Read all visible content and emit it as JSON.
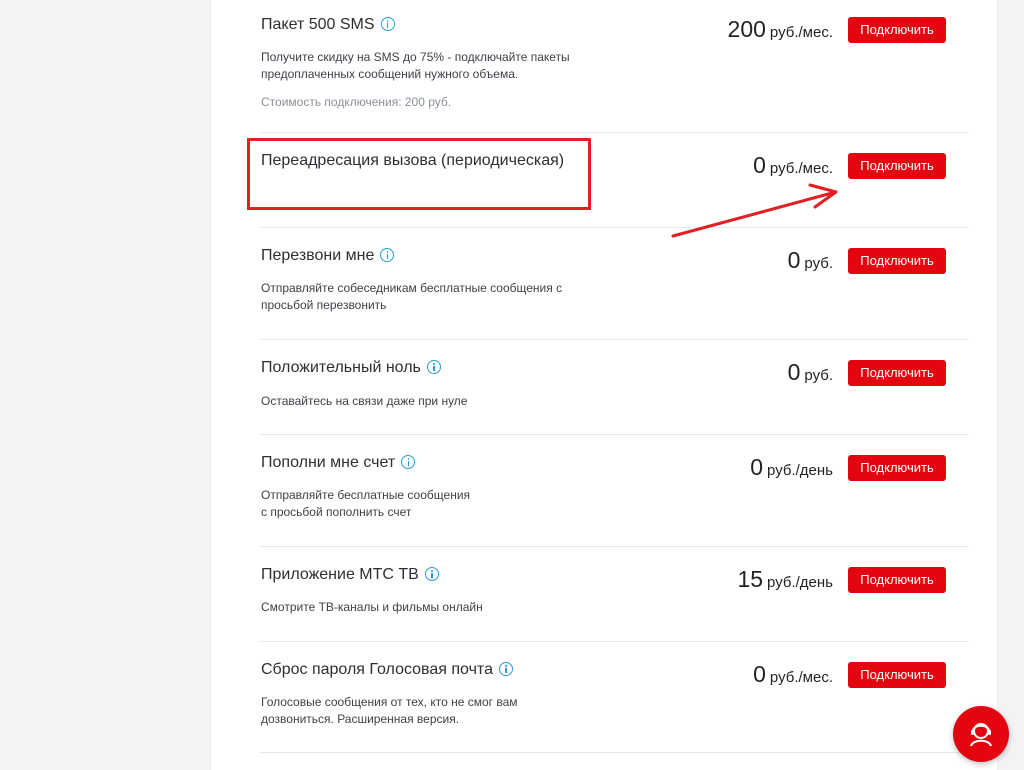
{
  "colors": {
    "accent": "#e30611",
    "info_icon": "#2a9bd3",
    "annotation": "#e31e24"
  },
  "services": [
    {
      "title": "Пакет 500 SMS",
      "has_info": true,
      "description": "Получите скидку на SMS до 75% - подключайте пакеты предоплаченных сообщений нужного объема.",
      "note": "Стоимость подключения: 200 руб.",
      "price": "200",
      "unit": "руб./мес.",
      "button": "Подключить"
    },
    {
      "title": "Переадресация вызова (периодическая)",
      "has_info": false,
      "description": "",
      "note": "",
      "price": "0",
      "unit": "руб./мес.",
      "button": "Подключить"
    },
    {
      "title": "Перезвони мне",
      "has_info": true,
      "description": "Отправляйте собеседникам бесплатные сообщения с просьбой перезвонить",
      "note": "",
      "price": "0",
      "unit": "руб.",
      "button": "Подключить"
    },
    {
      "title": "Положительный ноль",
      "has_info": true,
      "description": "Оставайтесь на связи даже при нуле",
      "note": "",
      "price": "0",
      "unit": "руб.",
      "button": "Подключить"
    },
    {
      "title": "Пополни мне счет",
      "has_info": true,
      "description": "Отправляйте бесплатные сообщения\nс просьбой пополнить счет",
      "note": "",
      "price": "0",
      "unit": "руб./день",
      "button": "Подключить"
    },
    {
      "title": "Приложение МТС ТВ",
      "has_info": true,
      "description": "Смотрите ТВ-каналы и фильмы онлайн",
      "note": "",
      "price": "15",
      "unit": "руб./день",
      "button": "Подключить"
    },
    {
      "title": "Сброс пароля Голосовая почта",
      "has_info": true,
      "description": "Голосовые сообщения от тех, кто не смог вам дозвониться. Расширенная версия.",
      "note": "",
      "price": "0",
      "unit": "руб./мес.",
      "button": "Подключить"
    }
  ],
  "chat": {
    "icon": "chat-support-icon"
  }
}
